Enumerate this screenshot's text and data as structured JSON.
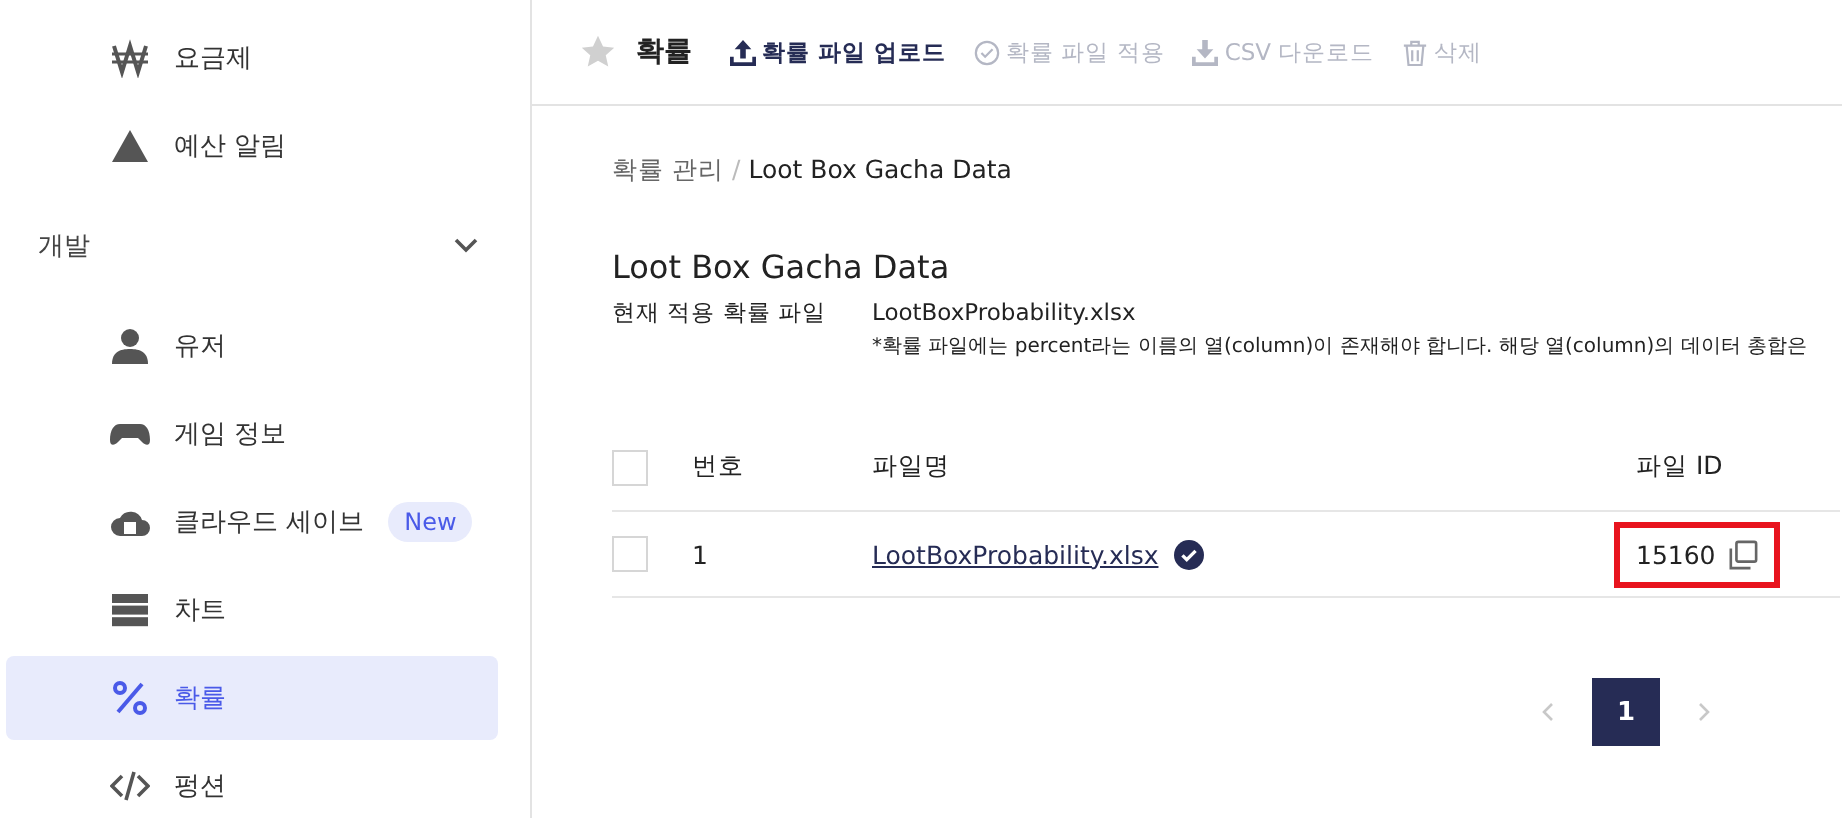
{
  "sidebar": {
    "items": [
      {
        "kind": "item",
        "label": "요금제",
        "selected": false
      },
      {
        "kind": "item",
        "label": "예산 알림",
        "selected": false
      },
      {
        "kind": "group",
        "label": "개발",
        "expanded": true
      },
      {
        "kind": "item",
        "label": "유저",
        "selected": false
      },
      {
        "kind": "item",
        "label": "게임 정보",
        "selected": false
      },
      {
        "kind": "item",
        "label": "클라우드 세이브",
        "badge": "New",
        "selected": false
      },
      {
        "kind": "item",
        "label": "차트",
        "selected": false
      },
      {
        "kind": "item",
        "label": "확률",
        "selected": true
      },
      {
        "kind": "item",
        "label": "펑션",
        "selected": false
      }
    ]
  },
  "toolbar": {
    "title": "확률",
    "favorite": false,
    "actions": [
      {
        "label": "확률 파일 업로드",
        "disabled": false
      },
      {
        "label": "확률 파일 적용",
        "disabled": true
      },
      {
        "label": "CSV 다운로드",
        "disabled": true
      },
      {
        "label": "삭제",
        "disabled": true
      }
    ]
  },
  "breadcrumb": {
    "separator": "/",
    "items": [
      "확률 관리",
      "Loot Box Gacha Data"
    ]
  },
  "heading": "Loot Box Gacha Data",
  "current_file": {
    "label": "현재 적용 확률 파일",
    "value": "LootBoxProbability.xlsx",
    "note": "*확률 파일에는 percent라는 이름의 열(column)이 존재해야 합니다. 해당 열(column)의 데이터 총합은"
  },
  "table": {
    "all_checked": false,
    "columns": [
      "번호",
      "파일명",
      "파일 ID"
    ],
    "rows": [
      {
        "checked": false,
        "number": "1",
        "file_name": "LootBoxProbability.xlsx",
        "applied": true,
        "file_id": "15160",
        "highlighted": true
      }
    ]
  },
  "pagination": {
    "pages": [
      {
        "label": "1",
        "selected": true
      }
    ]
  }
}
